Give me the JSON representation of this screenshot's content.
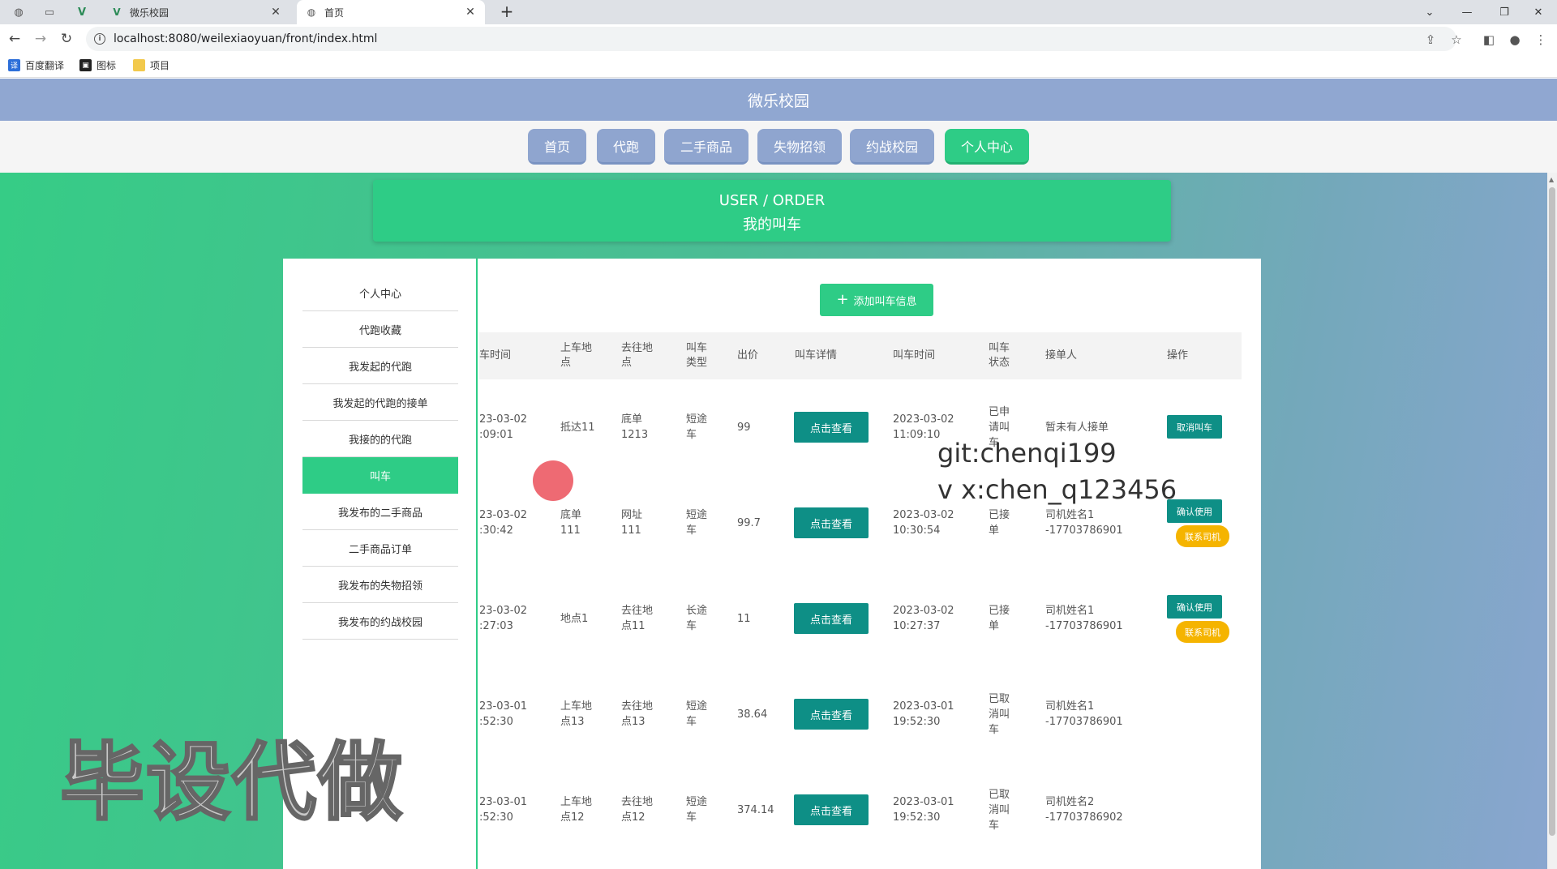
{
  "browser": {
    "tabs": [
      {
        "title": "微乐校园",
        "active": false
      },
      {
        "title": "首页",
        "active": true
      }
    ],
    "url": "localhost:8080/weilexiaoyuan/front/index.html",
    "bookmarks": [
      "百度翻译",
      "图标",
      "项目"
    ]
  },
  "site": {
    "title": "微乐校园",
    "nav": [
      "首页",
      "代跑",
      "二手商品",
      "失物招领",
      "约战校园",
      "个人中心"
    ],
    "nav_active": "个人中心",
    "banner_en": "USER / ORDER",
    "banner_cn": "我的叫车"
  },
  "sidebar": {
    "items": [
      "个人中心",
      "代跑收藏",
      "我发起的代跑",
      "我发起的代跑的接单",
      "我接的的代跑",
      "叫车",
      "我发布的二手商品",
      "二手商品订单",
      "我发布的失物招领",
      "我发布的约战校园"
    ],
    "active": "叫车"
  },
  "content": {
    "add_button": "添加叫车信息",
    "columns": [
      "车时间",
      "上车地点",
      "去往地点",
      "叫车类型",
      "出价",
      "叫车详情",
      "叫车时间",
      "叫车状态",
      "接单人",
      "操作"
    ],
    "rows": [
      {
        "time_a": "23-03-02",
        "time_b": ":09:01",
        "pickup": "抵达11",
        "dest": "底单1213",
        "type": "短途车",
        "price": "99",
        "detail_btn": "点击查看",
        "call_date": "2023-03-02",
        "call_time": "11:09:10",
        "status": "已申请叫车",
        "driver": "暂未有人接单",
        "driver2": "",
        "op1": "取消叫车",
        "op2": ""
      },
      {
        "time_a": "23-03-02",
        "time_b": ":30:42",
        "pickup": "底单111",
        "dest": "网址111",
        "type": "短途车",
        "price": "99.7",
        "detail_btn": "点击查看",
        "call_date": "2023-03-02",
        "call_time": "10:30:54",
        "status": "已接单",
        "driver": "司机姓名1",
        "driver2": "-17703786901",
        "op1": "确认使用",
        "op2": "联系司机"
      },
      {
        "time_a": "23-03-02",
        "time_b": ":27:03",
        "pickup": "地点1",
        "dest": "去往地点11",
        "type": "长途车",
        "price": "11",
        "detail_btn": "点击查看",
        "call_date": "2023-03-02",
        "call_time": "10:27:37",
        "status": "已接单",
        "driver": "司机姓名1",
        "driver2": "-17703786901",
        "op1": "确认使用",
        "op2": "联系司机"
      },
      {
        "time_a": "23-03-01",
        "time_b": ":52:30",
        "pickup": "上车地点13",
        "dest": "去往地点13",
        "type": "短途车",
        "price": "38.64",
        "detail_btn": "点击查看",
        "call_date": "2023-03-01",
        "call_time": "19:52:30",
        "status": "已取消叫车",
        "driver": "司机姓名1",
        "driver2": "-17703786901",
        "op1": "",
        "op2": ""
      },
      {
        "time_a": "23-03-01",
        "time_b": ":52:30",
        "pickup": "上车地点12",
        "dest": "去往地点12",
        "type": "短途车",
        "price": "374.14",
        "detail_btn": "点击查看",
        "call_date": "2023-03-01",
        "call_time": "19:52:30",
        "status": "已取消叫车",
        "driver": "司机姓名2",
        "driver2": "-17703786902",
        "op1": "",
        "op2": ""
      }
    ]
  },
  "overlay": {
    "line1": "git:chenqi199",
    "line2": "v x:chen_q123456",
    "watermark": "毕设代做"
  }
}
